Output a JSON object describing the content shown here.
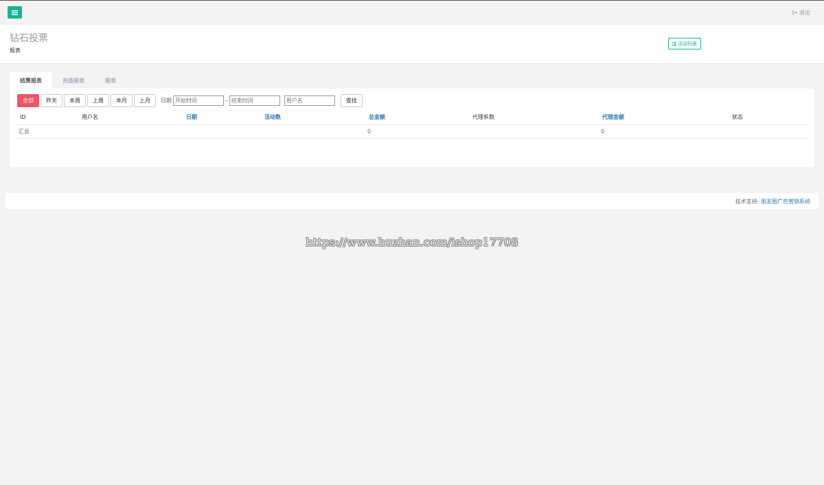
{
  "topbar": {
    "menu_icon": "hamburger-icon",
    "logout_label": "退出",
    "logout_icon": "sign-out-icon"
  },
  "header": {
    "title": "钻石投票",
    "subtitle": "报表",
    "list_button_label": "活动列表",
    "list_button_icon": "list-icon"
  },
  "tabs": [
    {
      "label": "结算报表",
      "active": true
    },
    {
      "label": "充值报表",
      "active": false
    },
    {
      "label": "图表",
      "active": false
    }
  ],
  "filters": {
    "buttons": [
      "全部",
      "昨天",
      "本周",
      "上周",
      "本月",
      "上月"
    ],
    "active_button": "全部",
    "date_label": "日期",
    "start_placeholder": "开始时间",
    "separator": "--",
    "end_placeholder": "结束时间",
    "username_placeholder": "用户名",
    "search_label": "查找"
  },
  "table": {
    "columns": [
      {
        "label": "ID",
        "sortable": false
      },
      {
        "label": "用户名",
        "sortable": false
      },
      {
        "label": "日期",
        "sortable": true
      },
      {
        "label": "活动数",
        "sortable": true
      },
      {
        "label": "总金额",
        "sortable": true
      },
      {
        "label": "代理系数",
        "sortable": false
      },
      {
        "label": "代理金额",
        "sortable": true
      },
      {
        "label": "状态",
        "sortable": false
      }
    ],
    "summary_row": {
      "label": "汇总",
      "total_amount": "0",
      "agent_amount": "0"
    }
  },
  "footer": {
    "support_label": "技术支持:",
    "support_link": "朋友圈广告营销系统"
  },
  "watermark": "https://www.huzhan.com/ishop17708",
  "colors": {
    "accent": "#1ab394",
    "danger": "#ed5565",
    "link": "#337ab7"
  }
}
